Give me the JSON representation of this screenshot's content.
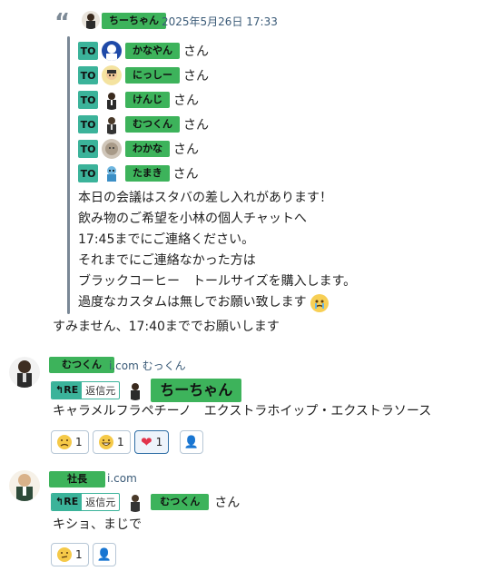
{
  "quote": {
    "author": "ちーちゃん",
    "timestamp": "2025年5月26日 17:33",
    "mentions": [
      {
        "to": "TO",
        "name": "かなやん",
        "suffix": "さん"
      },
      {
        "to": "TO",
        "name": "にっしー",
        "suffix": "さん"
      },
      {
        "to": "TO",
        "name": "けんじ",
        "suffix": "さん"
      },
      {
        "to": "TO",
        "name": "むつくん",
        "suffix": "さん"
      },
      {
        "to": "TO",
        "name": "わかな",
        "suffix": "さん"
      },
      {
        "to": "TO",
        "name": "たまき",
        "suffix": "さん"
      }
    ],
    "lines": [
      "本日の会議はスタバの差し入れがあります！",
      "飲み物のご希望を小林の個人チャットへ",
      "17:45までにご連絡ください。",
      "それまでにご連絡なかった方は",
      "ブラックコーヒー　トールサイズを購入します。",
      "過度なカスタムは無しでお願い致します"
    ],
    "reply_text": "すみません、17:40まででお願いします"
  },
  "message1": {
    "sender": "むつくん",
    "org": "i.com むっくん",
    "re_label": "RE",
    "re_source": "返信元",
    "reply_to": "ちーちゃん",
    "text": "キャラメルフラペチーノ　エクストラホイップ・エクストラソース",
    "reactions": [
      {
        "icon": "frown-face-icon",
        "count": "1"
      },
      {
        "icon": "grin-face-icon",
        "count": "1"
      },
      {
        "icon": "heart-icon",
        "count": "1"
      }
    ]
  },
  "message2": {
    "sender": "社長",
    "org": "i.com",
    "re_label": "RE",
    "re_source": "返信元",
    "reply_to": "むつくん",
    "reply_suffix": "さん",
    "text": "キショ、まじで",
    "reactions": [
      {
        "icon": "thinking-face-icon",
        "count": "1"
      }
    ]
  }
}
